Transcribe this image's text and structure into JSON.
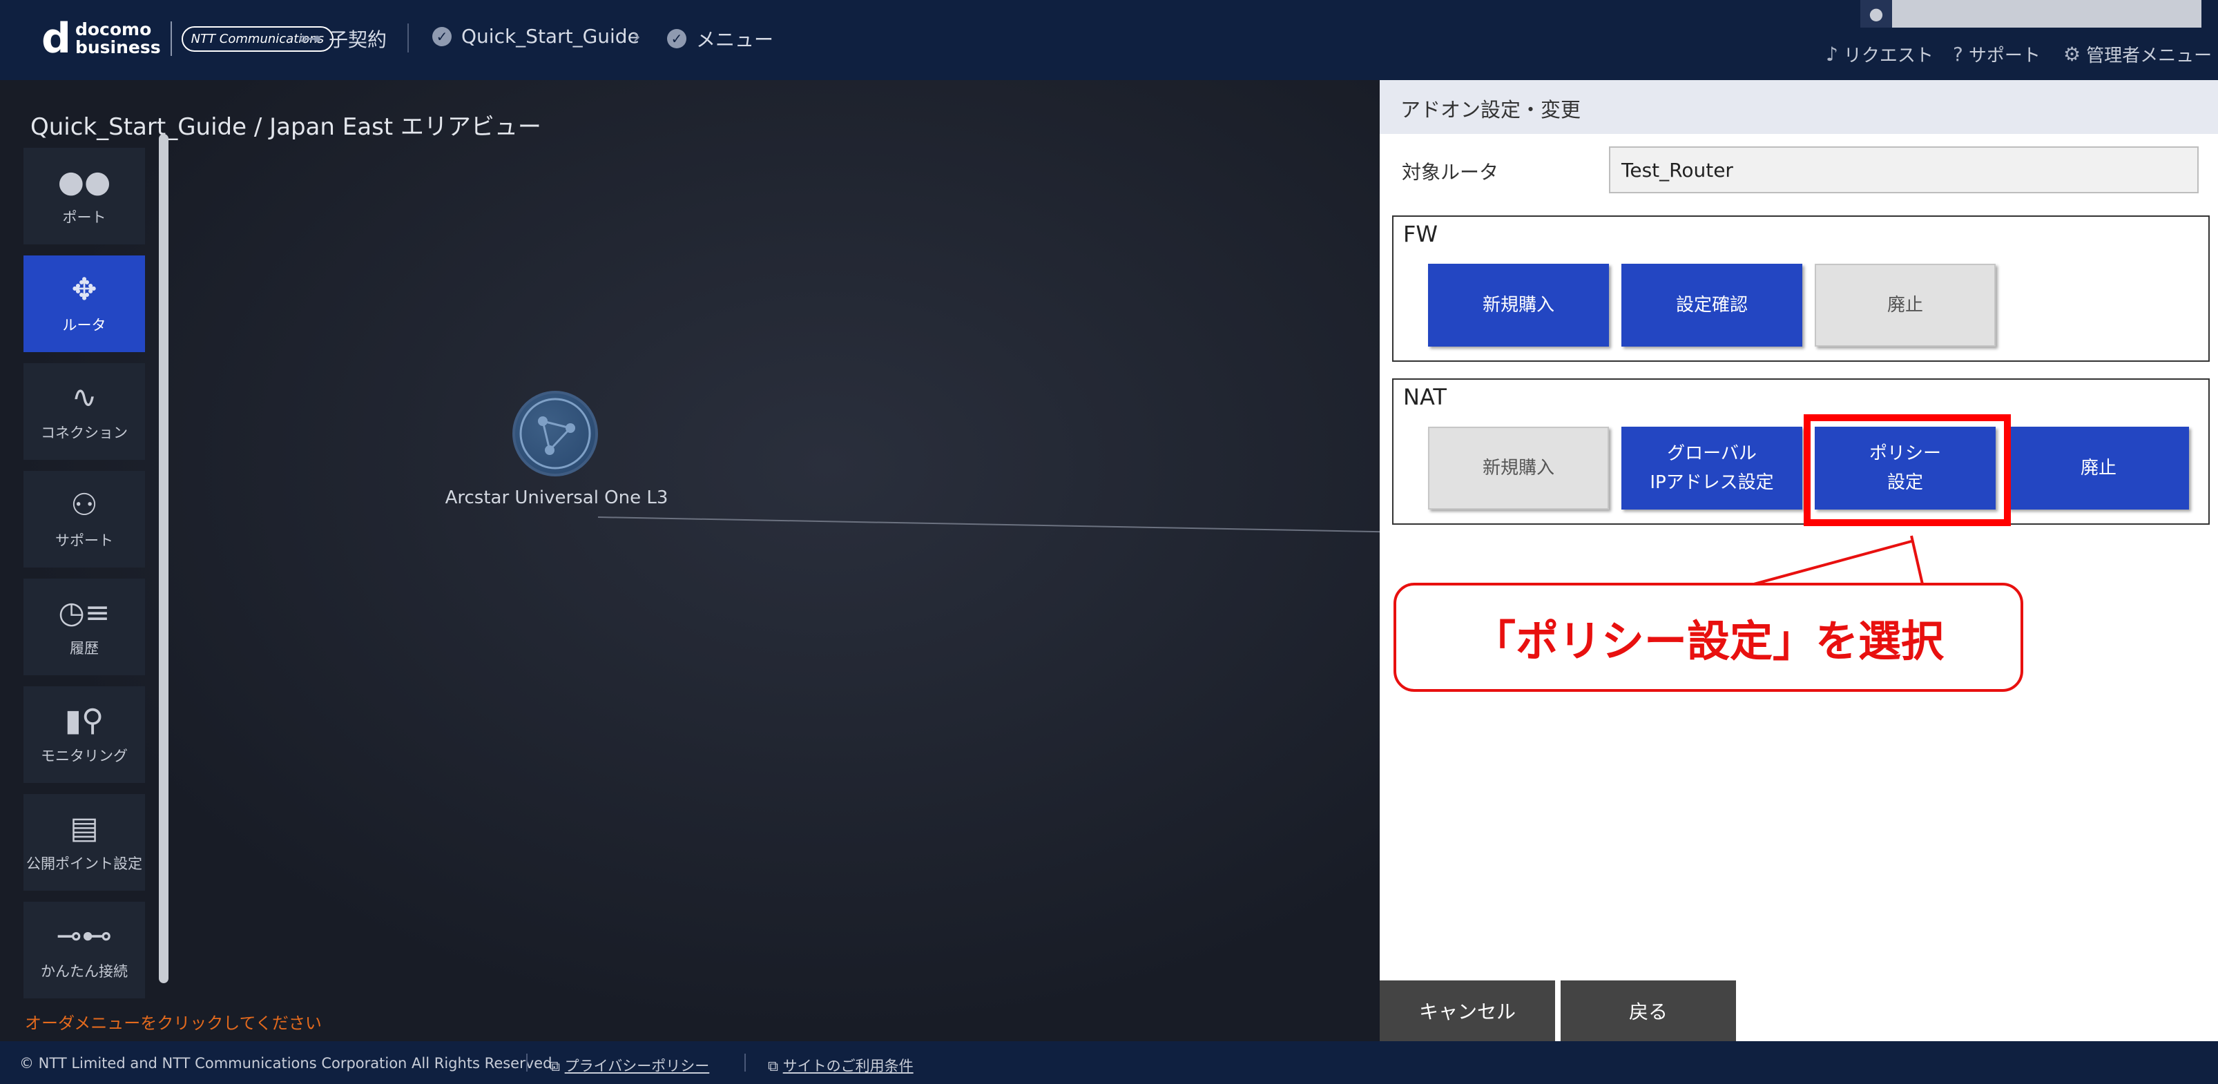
{
  "header": {
    "logo_mark": "d",
    "logo_text_line1": "docomo",
    "logo_text_line2": "business",
    "logo_partner": "NTT Communications",
    "contract_label": "子契約",
    "breadcrumb_1": "Quick_Start_Guide",
    "breadcrumb_2": "メニュー",
    "menu_request": "リクエスト",
    "menu_support": "サポート",
    "menu_admin": "管理者メニュー"
  },
  "canvas": {
    "area_title": "Quick_Start_Guide / Japan East エリアビュー",
    "order_hint": "オーダメニューをクリックしてください",
    "node_label": "Arcstar Universal One L3"
  },
  "sidebar": {
    "items": [
      {
        "label": "ポート",
        "icon": "port-icon"
      },
      {
        "label": "ルータ",
        "icon": "router-icon"
      },
      {
        "label": "コネクション",
        "icon": "connection-icon"
      },
      {
        "label": "サポート",
        "icon": "support-icon"
      },
      {
        "label": "履歴",
        "icon": "history-icon"
      },
      {
        "label": "モニタリング",
        "icon": "monitoring-icon"
      },
      {
        "label": "公開ポイント設定",
        "icon": "public-point-icon"
      },
      {
        "label": "かんたん接続",
        "icon": "easy-connect-icon"
      }
    ]
  },
  "panel": {
    "title": "アドオン設定・変更",
    "router_label": "対象ルータ",
    "router_value": "Test_Router",
    "fw": {
      "title": "FW",
      "new_purchase": "新規購入",
      "confirm_settings": "設定確認",
      "abolish": "廃止"
    },
    "nat": {
      "title": "NAT",
      "new_purchase": "新規購入",
      "global_ip": "グローバル\nIPアドレス設定",
      "policy": "ポリシー\n設定",
      "abolish": "廃止"
    },
    "callout": "「ポリシー設定」を選択",
    "cancel": "キャンセル",
    "back": "戻る"
  },
  "footer": {
    "copyright": "© NTT Limited and NTT Communications Corporation All Rights Reserved.",
    "privacy": "プライバシーポリシー",
    "terms": "サイトのご利用条件"
  },
  "colors": {
    "header_bg": "#0f2040",
    "accent_blue": "#2346c2",
    "highlight_red": "#ff0000",
    "hint_orange": "#e46a1d"
  }
}
